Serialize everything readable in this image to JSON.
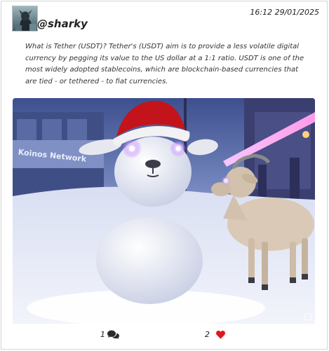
{
  "post": {
    "username": "@sharky",
    "timestamp": "16:12 29/01/2025",
    "text": "What is Tether (USDT)? Tether's (USDT) aim is to provide a less volatile digital currency by pegging its value to the US dollar at a 1:1 ratio. USDT is one of the most widely adopted stablecoins, which are blockchain-based currencies that are tied - or tethered - to fiat currencies.",
    "image": {
      "sign_text": "Koinos Network"
    },
    "stats": {
      "comments": "1",
      "likes": "2"
    }
  },
  "colors": {
    "heart": "#e0161e",
    "comment_icon": "#2b2b2b",
    "border": "#d5d5d5"
  },
  "icons": {
    "comments": "comment-bubbles-icon",
    "likes": "heart-icon",
    "expand": "expand-icon"
  }
}
